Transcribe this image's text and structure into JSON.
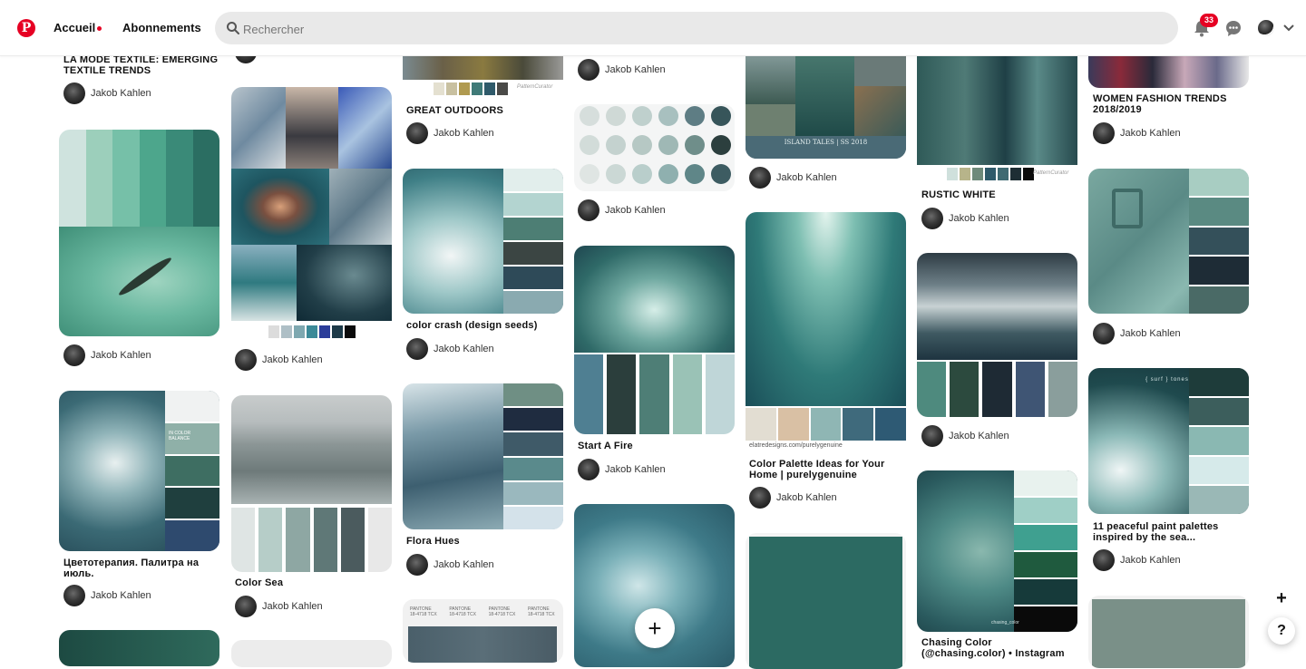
{
  "header": {
    "nav_home": "Accueil",
    "nav_following": "Abonnements",
    "search_placeholder": "Rechercher",
    "notification_count": "33"
  },
  "author": "Jakob Kahlen",
  "pins": [
    {
      "title": "LA MODE TEXTILE: EMERGING TEXTILE TRENDS"
    },
    {
      "title": "Цветотерапия. Палитра на июль."
    },
    {
      "title": "GREAT OUTDOORS"
    },
    {
      "title": "color crash (design seeds)"
    },
    {
      "title": "Flora Hues"
    },
    {
      "title": "Color Sea"
    },
    {
      "title": "Start A Fire"
    },
    {
      "title": "Color Palette Ideas for Your Home | purelygenuine"
    },
    {
      "title": "RUSTIC WHITE"
    },
    {
      "title": "Chasing Color (@chasing.color) • Instagram"
    },
    {
      "title": "WOMEN FASHION TRENDS 2018/2019"
    },
    {
      "title": "11 peaceful paint palettes inspired by the sea..."
    }
  ],
  "image_texts": {
    "island_tales": "ISLAND TALES | SS 2018",
    "elatre": "elatredesigns.com/purelygenuine",
    "pattern_curator": "PatternCurator",
    "in_color_balance": "IN COLOR BALANCE",
    "surf_tones": "{ surf } tones",
    "pantone": "PANTONE 18-4718 TCX",
    "chasing_color": "chasing_color"
  },
  "colors": {
    "brand": "#e60023",
    "search_bg": "#e9e9e9"
  }
}
